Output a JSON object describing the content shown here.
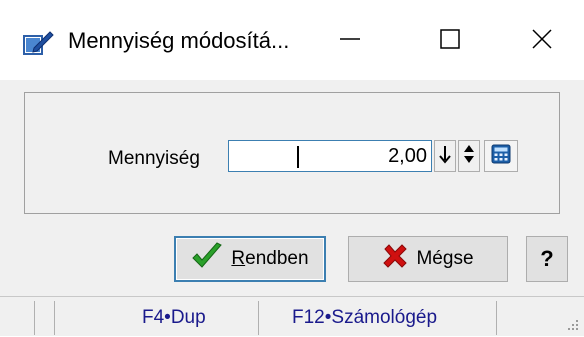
{
  "window": {
    "title": "Mennyiség módosítá...",
    "icon": "pencil-checkbox-icon",
    "controls": {
      "minimize": "minimize-icon",
      "maximize": "maximize-icon",
      "close": "close-icon"
    }
  },
  "form": {
    "quantity_label": "Mennyiség",
    "quantity_value": "2,00",
    "down_button_icon": "arrow-down-icon",
    "spin_button_icon": "spin-updown-icon",
    "calculator_icon": "calculator-icon"
  },
  "buttons": {
    "ok_label": "Rendben",
    "cancel_label": "Mégse",
    "help_label": "?"
  },
  "statusbar": {
    "dup_hint": "F4•Dup",
    "calc_hint": "F12•Számológép"
  },
  "colors": {
    "ok_check": "#2aa02a",
    "cancel_x": "#d01010",
    "focus_border": "#3c7fb1",
    "status_text": "#1a1a8c"
  }
}
